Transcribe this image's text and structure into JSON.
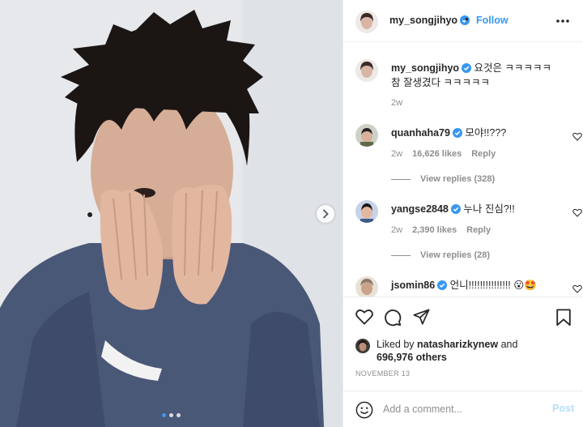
{
  "post": {
    "account": "my_songjihyo",
    "separator": "•",
    "follow_label": "Follow",
    "caption": {
      "username": "my_songjihyo",
      "text": "요것은 ㅋㅋㅋㅋㅋ 참 잘생겼다 ㅋㅋㅋㅋㅋ",
      "time": "2w"
    },
    "carousel": {
      "slides": 3,
      "active_slide": 1
    },
    "likes_text_prefix": "Liked by",
    "liked_by_user": "natasharizkynew",
    "likes_text_and": "and",
    "likes_others": "696,976 others",
    "date": "NOVEMBER 13"
  },
  "comments": [
    {
      "username": "quanhaha79",
      "text": "모야!!???",
      "time": "2w",
      "likes": "16,626 likes",
      "reply_label": "Reply",
      "view_replies": "View replies (328)"
    },
    {
      "username": "yangse2848",
      "text": "누나 진심?!!",
      "time": "2w",
      "likes": "2,390 likes",
      "reply_label": "Reply",
      "view_replies": "View replies (28)"
    },
    {
      "username": "jsomin86",
      "text": "언니!!!!!!!!!!!!!!! 😮🤩"
    }
  ],
  "composer": {
    "placeholder": "Add a comment...",
    "post_label": "Post"
  },
  "colors": {
    "link_blue": "#3897f0",
    "verified_blue": "#3897f0",
    "muted": "#8e8e8e",
    "post_disabled": "#b2dffc"
  },
  "icons": {
    "verified": "verified-badge-icon",
    "more": "more-options-icon",
    "heart": "heart-icon",
    "comment": "comment-icon",
    "share": "share-icon",
    "bookmark": "bookmark-icon",
    "emoji": "emoji-icon",
    "next": "chevron-right-icon"
  }
}
